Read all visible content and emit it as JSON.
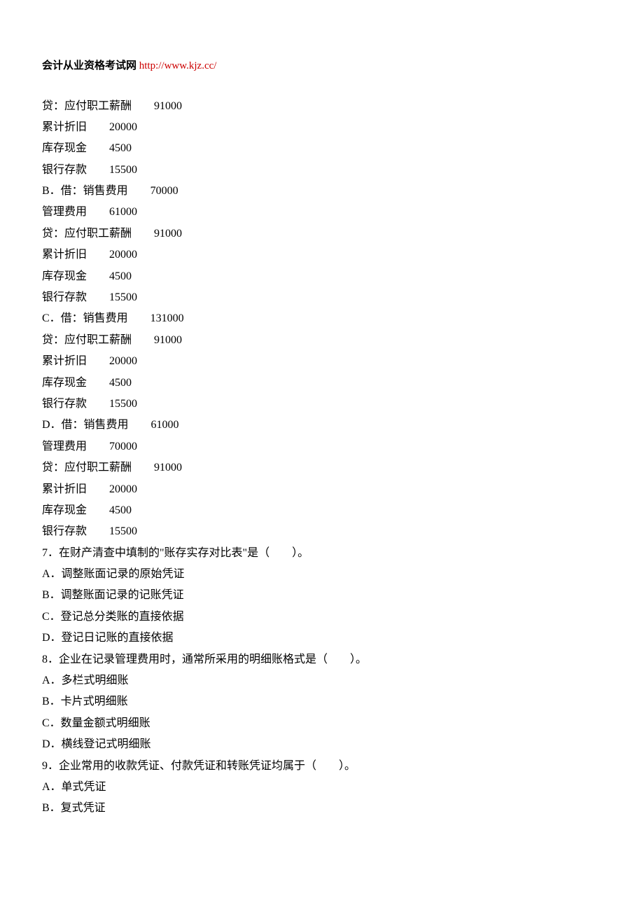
{
  "header": {
    "title": "会计从业资格考试网",
    "link": "http://www.kjz.cc/"
  },
  "lines": [
    "贷：应付职工薪酬　　91000",
    "累计折旧　　20000",
    "库存现金　　4500",
    "银行存款　　15500",
    "B．借：销售费用　　70000",
    "管理费用　　61000",
    "贷：应付职工薪酬　　91000",
    "累计折旧　　20000",
    "库存现金　　4500",
    "银行存款　　15500",
    "C．借：销售费用　　131000",
    "贷：应付职工薪酬　　91000",
    "累计折旧　　20000",
    "库存现金　　4500",
    "银行存款　　15500",
    "D．借：销售费用　　61000",
    "管理费用　　70000",
    "贷：应付职工薪酬　　91000",
    "累计折旧　　20000",
    "库存现金　　4500",
    "银行存款　　15500",
    "7．在财产清查中填制的\"账存实存对比表\"是（　　）。",
    "A．调整账面记录的原始凭证",
    "B．调整账面记录的记账凭证",
    "C．登记总分类账的直接依据",
    "D．登记日记账的直接依据",
    "8．企业在记录管理费用时，通常所采用的明细账格式是（　　）。",
    "A．多栏式明细账",
    "B．卡片式明细账",
    "C．数量金额式明细账",
    "D．横线登记式明细账",
    "9．企业常用的收款凭证、付款凭证和转账凭证均属于（　　）。",
    "A．单式凭证",
    "B．复式凭证"
  ]
}
